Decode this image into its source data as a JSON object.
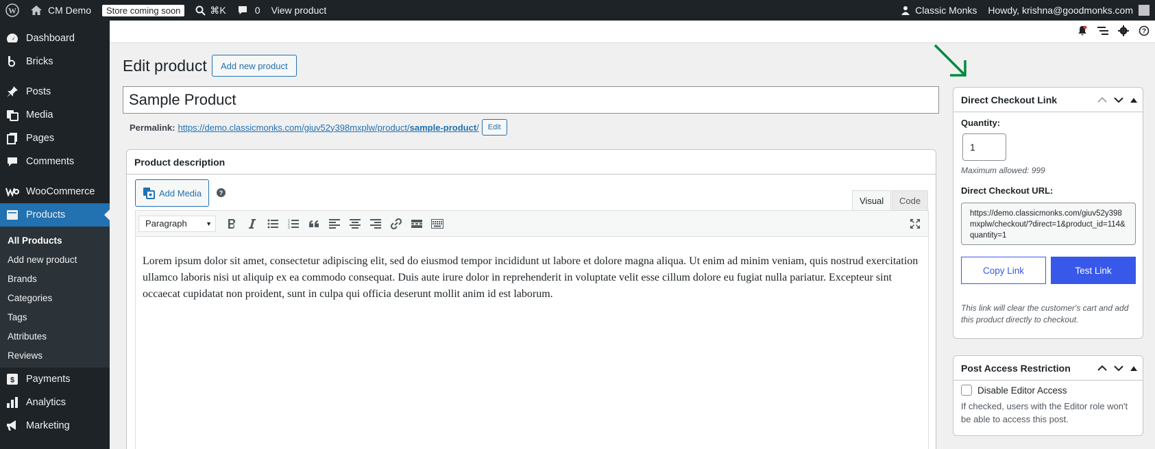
{
  "adminbar": {
    "site_name": "CM Demo",
    "store_badge": "Store coming soon",
    "search_shortcut": "⌘K",
    "comments_count": "0",
    "view_product": "View product",
    "account_name": "Classic Monks",
    "howdy": "Howdy, krishna@goodmonks.com"
  },
  "sidebar": {
    "items_top": [
      {
        "label": "Dashboard",
        "icon": "dashboard-icon"
      },
      {
        "label": "Bricks",
        "icon": "bricks-icon"
      }
    ],
    "items_mid": [
      {
        "label": "Posts",
        "icon": "pin-icon"
      },
      {
        "label": "Media",
        "icon": "media-icon"
      },
      {
        "label": "Pages",
        "icon": "pages-icon"
      },
      {
        "label": "Comments",
        "icon": "comment-icon"
      }
    ],
    "woocommerce": "WooCommerce",
    "products": "Products",
    "submenu": [
      "All Products",
      "Add new product",
      "Brands",
      "Categories",
      "Tags",
      "Attributes",
      "Reviews"
    ],
    "items_bottom": [
      {
        "label": "Payments",
        "icon": "payments-icon"
      },
      {
        "label": "Analytics",
        "icon": "analytics-icon"
      },
      {
        "label": "Marketing",
        "icon": "megaphone-icon"
      }
    ]
  },
  "main": {
    "page_title": "Edit product",
    "add_new_button": "Add new product",
    "product_title": "Sample Product",
    "permalink_label": "Permalink:",
    "permalink_base": "https://demo.classicmonks.com/giuv52y398mxplw/product/",
    "permalink_slug": "sample-product",
    "permalink_trail": "/",
    "edit_button": "Edit"
  },
  "description": {
    "heading": "Product description",
    "add_media": "Add Media",
    "help": "?",
    "tab_visual": "Visual",
    "tab_code": "Code",
    "format": "Paragraph",
    "content": "Lorem ipsum dolor sit amet, consectetur adipiscing elit, sed do eiusmod tempor incididunt ut labore et dolore magna aliqua. Ut enim ad minim veniam, quis nostrud exercitation ullamco laboris nisi ut aliquip ex ea commodo consequat. Duis aute irure dolor in reprehenderit in voluptate velit esse cillum dolore eu fugiat nulla pariatur. Excepteur sint occaecat cupidatat non proident, sunt in culpa qui officia deserunt mollit anim id est laborum."
  },
  "checkout_panel": {
    "title": "Direct Checkout Link",
    "quantity_label": "Quantity:",
    "quantity_value": "1",
    "max_allowed": "Maximum allowed: 999",
    "url_label": "Direct Checkout URL:",
    "url_value": "https://demo.classicmonks.com/giuv52y398mxplw/checkout/?direct=1&product_id=114&quantity=1",
    "copy_button": "Copy Link",
    "test_button": "Test Link",
    "note": "This link will clear the customer's cart and add this product directly to checkout."
  },
  "access_panel": {
    "title": "Post Access Restriction",
    "checkbox_label": "Disable Editor Access",
    "description": "If checked, users with the Editor role won't be able to access this post."
  },
  "colors": {
    "admin_bar": "#1d2327",
    "accent": "#2271b1",
    "button_blue": "#3858e9",
    "arrow": "#008a3e"
  }
}
